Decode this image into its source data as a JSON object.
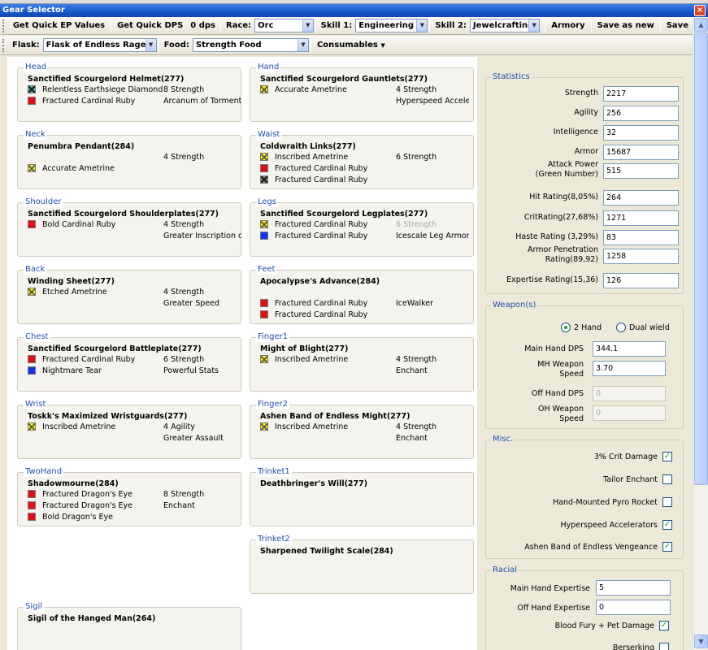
{
  "window": {
    "title": "Gear Selector",
    "close_glyph": "×"
  },
  "toolbar1": {
    "quick_ep": "Get Quick EP Values",
    "quick_dps": "Get Quick DPS",
    "dps_value": "0 dps",
    "race_label": "Race:",
    "race_value": "Orc",
    "skill1_label": "Skill 1:",
    "skill1_value": "Engineering",
    "skill2_label": "Skill 2:",
    "skill2_value": "Jewelcrafting",
    "armory": "Armory",
    "save_as_new": "Save as new",
    "save": "Save"
  },
  "toolbar2": {
    "flask_label": "Flask:",
    "flask_value": "Flask of Endless Rage",
    "food_label": "Food:",
    "food_value": "Strength Food",
    "consumables": "Consumables"
  },
  "icons": {
    "dropdown": "▼",
    "scroll_up": "▲",
    "scroll_down": "▼",
    "check": "✓"
  },
  "gem_colors": {
    "meta": "#3fd0d8",
    "red": "#dd1111",
    "yellow": "#ffef00",
    "blue": "#1133ee",
    "prismatic": "#8a8a8a"
  },
  "slots": {
    "head": {
      "title": "Head",
      "item": "Sanctified Scourgelord Helmet(277)",
      "gems": [
        "Relentless Earthsiege Diamond",
        "Fractured Cardinal Ruby"
      ],
      "enchants": [
        "8 Strength",
        "Arcanum of Torment"
      ]
    },
    "hand": {
      "title": "Hand",
      "item": "Sanctified Scourgelord Gauntlets(277)",
      "gems": [
        "Accurate Ametrine"
      ],
      "enchants": [
        "4 Strength",
        "Hyperspeed Accelerators"
      ]
    },
    "neck": {
      "title": "Neck",
      "item": "Penumbra Pendant(284)",
      "gems": [
        "Accurate Ametrine"
      ],
      "enchants": [
        "4 Strength"
      ]
    },
    "waist": {
      "title": "Waist",
      "item": "Coldwraith Links(277)",
      "gems": [
        "Inscribed Ametrine",
        "Fractured Cardinal Ruby",
        "Fractured Cardinal Ruby"
      ],
      "enchants": [
        "6 Strength"
      ]
    },
    "shoulder": {
      "title": "Shoulder",
      "item": "Sanctified Scourgelord Shoulderplates(277)",
      "gems": [
        "Bold Cardinal Ruby"
      ],
      "enchants": [
        "4 Strength",
        "Greater Inscription of the Axe"
      ]
    },
    "legs": {
      "title": "Legs",
      "item": "Sanctified Scourgelord Legplates(277)",
      "gems": [
        "Fractured Cardinal Ruby",
        "Fractured Cardinal Ruby"
      ],
      "enchants": [
        "6 Strength",
        "Icescale Leg Armor"
      ]
    },
    "back": {
      "title": "Back",
      "item": "Winding Sheet(277)",
      "gems": [
        "Etched Ametrine"
      ],
      "enchants": [
        "4 Strength",
        "Greater Speed"
      ]
    },
    "feet": {
      "title": "Feet",
      "item": "Apocalypse's Advance(284)",
      "gems": [
        "Fractured Cardinal Ruby",
        "Fractured Cardinal Ruby"
      ],
      "enchants": [
        "IceWalker"
      ]
    },
    "chest": {
      "title": "Chest",
      "item": "Sanctified Scourgelord Battleplate(277)",
      "gems": [
        "Fractured Cardinal Ruby",
        "Nightmare Tear"
      ],
      "enchants": [
        "6 Strength",
        "Powerful Stats"
      ]
    },
    "finger1": {
      "title": "Finger1",
      "item": "Might of Blight(277)",
      "gems": [
        "Inscribed Ametrine"
      ],
      "enchants": [
        "4 Strength",
        "Enchant"
      ]
    },
    "wrist": {
      "title": "Wrist",
      "item": "Toskk's Maximized Wristguards(277)",
      "gems": [
        "Inscribed Ametrine"
      ],
      "enchants": [
        "4 Agility",
        "Greater Assault"
      ]
    },
    "finger2": {
      "title": "Finger2",
      "item": "Ashen Band of Endless Might(277)",
      "gems": [
        "Inscribed Ametrine"
      ],
      "enchants": [
        "4 Strength",
        "Enchant"
      ]
    },
    "twohand": {
      "title": "TwoHand",
      "item": "Shadowmourne(284)",
      "gems": [
        "Fractured Dragon's Eye",
        "Fractured Dragon's Eye",
        "Bold Dragon's Eye"
      ],
      "enchants": [
        "8 Strength",
        "Enchant"
      ]
    },
    "trinket1": {
      "title": "Trinket1",
      "item": "Deathbringer's Will(277)"
    },
    "trinket2": {
      "title": "Trinket2",
      "item": "Sharpened Twilight Scale(284)"
    },
    "sigil": {
      "title": "Sigil",
      "item": "Sigil of the Hanged Man(264)"
    }
  },
  "statistics": {
    "title": "Statistics",
    "rows": [
      {
        "label": "Strength",
        "value": "2217"
      },
      {
        "label": "Agility",
        "value": "256"
      },
      {
        "label": "Intelligence",
        "value": "32"
      },
      {
        "label": "Armor",
        "value": "15687"
      },
      {
        "label": "Attack Power",
        "label2": "(Green Number)",
        "value": "515"
      },
      {
        "label": "Hit Rating(8,05%)",
        "value": "264"
      },
      {
        "label": "CritRating(27,68%)",
        "value": "1271"
      },
      {
        "label": "Haste Rating (3,29%)",
        "value": "83"
      },
      {
        "label": "Armor Penetration",
        "label2": "Rating(89,92)",
        "value": "1258"
      },
      {
        "label": "Expertise Rating(15,36)",
        "value": "126"
      }
    ]
  },
  "weapons": {
    "title": "Weapon(s)",
    "two_hand": "2 Hand",
    "dual_wield": "Dual wield",
    "mh_dps_label": "Main Hand DPS",
    "mh_dps": "344.1",
    "mh_speed_label": "MH Weapon",
    "mh_speed_label2": "Speed",
    "mh_speed": "3.70",
    "oh_dps_label": "Off Hand DPS",
    "oh_dps": "0",
    "oh_speed_label": "OH Weapon",
    "oh_speed_label2": "Speed",
    "oh_speed": "0"
  },
  "misc": {
    "title": "Misc.",
    "items": [
      {
        "label": "3% Crit Damage",
        "checked": "✓"
      },
      {
        "label": "Tailor Enchant",
        "checked": ""
      },
      {
        "label": "Hand-Mounted Pyro Rocket",
        "checked": ""
      },
      {
        "label": "Hyperspeed Accelerators",
        "checked": "✓"
      },
      {
        "label": "Ashen Band of Endless Vengeance",
        "checked": "✓"
      }
    ]
  },
  "racial": {
    "title": "Racial",
    "mh_exp_label": "Main Hand Expertise",
    "mh_exp": "5",
    "oh_exp_label": "Off Hand Expertise",
    "oh_exp": "0",
    "blood_fury": "Blood Fury + Pet Damage",
    "blood_fury_checked": "✓",
    "berserking": "Berserking",
    "berserking_checked": ""
  }
}
